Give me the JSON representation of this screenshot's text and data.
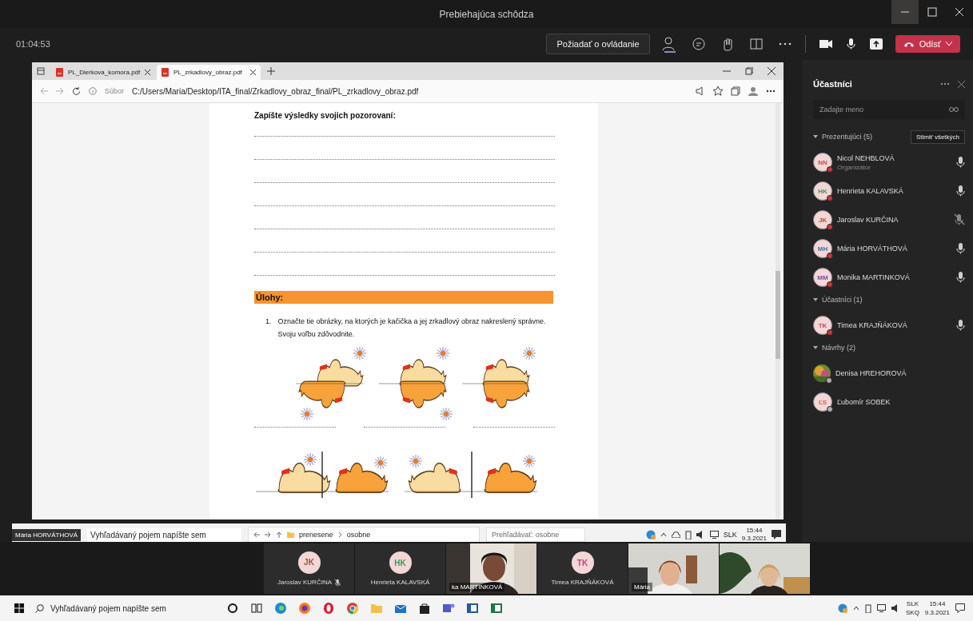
{
  "window": {
    "title": "Prebiehajúca schôdza"
  },
  "meeting_bar": {
    "timer": "01:04:53",
    "request_control": "Požiadať o ovládanie",
    "leave": "Odísť"
  },
  "shared_screen": {
    "presenter": "Mária HORVÁTHOVÁ",
    "browser": {
      "tabs": [
        {
          "label": "PL_Dierkova_komora.pdf",
          "selected": false
        },
        {
          "label": "PL_zrkadlovy_obraz.pdf",
          "selected": true
        }
      ],
      "address_prefix": "Súbor",
      "address": "C:/Users/Maria/Desktop/ITA_final/Zrkadlovy_obraz_final/PL_zrkadlovy_obraz.pdf"
    },
    "document": {
      "heading": "Zapíšte výsledky svojich pozorovaní:",
      "section": "Úlohy:",
      "tasks": [
        {
          "number": "1.",
          "text": "Označte tie obrázky, na ktorých je kačička a jej zrkadlový obraz nakreslený správne. Svoju voľbu zdôvodnite."
        }
      ]
    },
    "remote_taskbar": {
      "search_placeholder": "Vyhľadávaný pojem napíšte sem",
      "path": [
        "prenesene",
        "osobne"
      ],
      "explorer_search": "Prehľadávať: osobne",
      "language": "SLK",
      "time": "15:44",
      "date": "9.3.2021"
    }
  },
  "participants": {
    "title": "Účastníci",
    "search": {
      "placeholder": "Zadajte meno"
    },
    "mute_all": "Stlmiť všetkých",
    "groups": [
      {
        "label": "Prezentujúci (5)",
        "expanded": true,
        "people": [
          {
            "kind": "initials",
            "initials": "NN",
            "name": "Nicol NEHBLOVÁ",
            "role": "Organizátor",
            "color": "#c0504d",
            "busy": true,
            "muted": false
          },
          {
            "kind": "initials",
            "initials": "HK",
            "name": "Henrieta KALAVSKÁ",
            "color": "#3a9a5b",
            "busy": true,
            "muted": false
          },
          {
            "kind": "initials",
            "initials": "JK",
            "name": "Jaroslav KURČINA",
            "color": "#a0522d",
            "busy": true,
            "muted": true
          },
          {
            "kind": "initials",
            "initials": "MH",
            "name": "Mária HORVÁTHOVÁ",
            "color": "#3d6fa8",
            "busy": true,
            "muted": false
          },
          {
            "kind": "initials",
            "initials": "MM",
            "name": "Monika MARTINKOVÁ",
            "color": "#6b4fa8",
            "busy": true,
            "muted": false
          }
        ]
      },
      {
        "label": "Účastníci (1)",
        "expanded": true,
        "people": [
          {
            "kind": "initials",
            "initials": "TK",
            "name": "Timea KRAJŇÁKOVÁ",
            "color": "#c2447a",
            "busy": true,
            "muted": false
          }
        ]
      },
      {
        "label": "Návrhy (2)",
        "expanded": true,
        "people": [
          {
            "kind": "picture",
            "name": "Denisa HREHOROVÁ",
            "busy": false
          },
          {
            "kind": "initials",
            "initials": "ĽS",
            "name": "Ľubomír SOBEK",
            "color": "#c0704d",
            "busy": false
          }
        ]
      }
    ]
  },
  "video_strip": {
    "tiles": [
      {
        "kind": "avatar",
        "initials": "JK",
        "name": "Jaroslav KURČINA",
        "color": "#a0522d",
        "muted": true
      },
      {
        "kind": "avatar",
        "initials": "HK",
        "name": "Henrieta KALAVSKÁ",
        "color": "#3a9a5b",
        "muted": false
      },
      {
        "kind": "video",
        "name": "ka MARTINKOVÁ"
      },
      {
        "kind": "avatar",
        "initials": "TK",
        "name": "Timea KRAJŇÁKOVÁ",
        "color": "#c2447a",
        "muted": false
      },
      {
        "kind": "video",
        "name": "Mária"
      },
      {
        "kind": "video"
      }
    ]
  },
  "taskbar": {
    "search_placeholder": "Vyhľadávaný pojem napíšte sem",
    "language": [
      "SLK",
      "SKQ"
    ],
    "time": "15:44",
    "date": "9.3.2021"
  }
}
